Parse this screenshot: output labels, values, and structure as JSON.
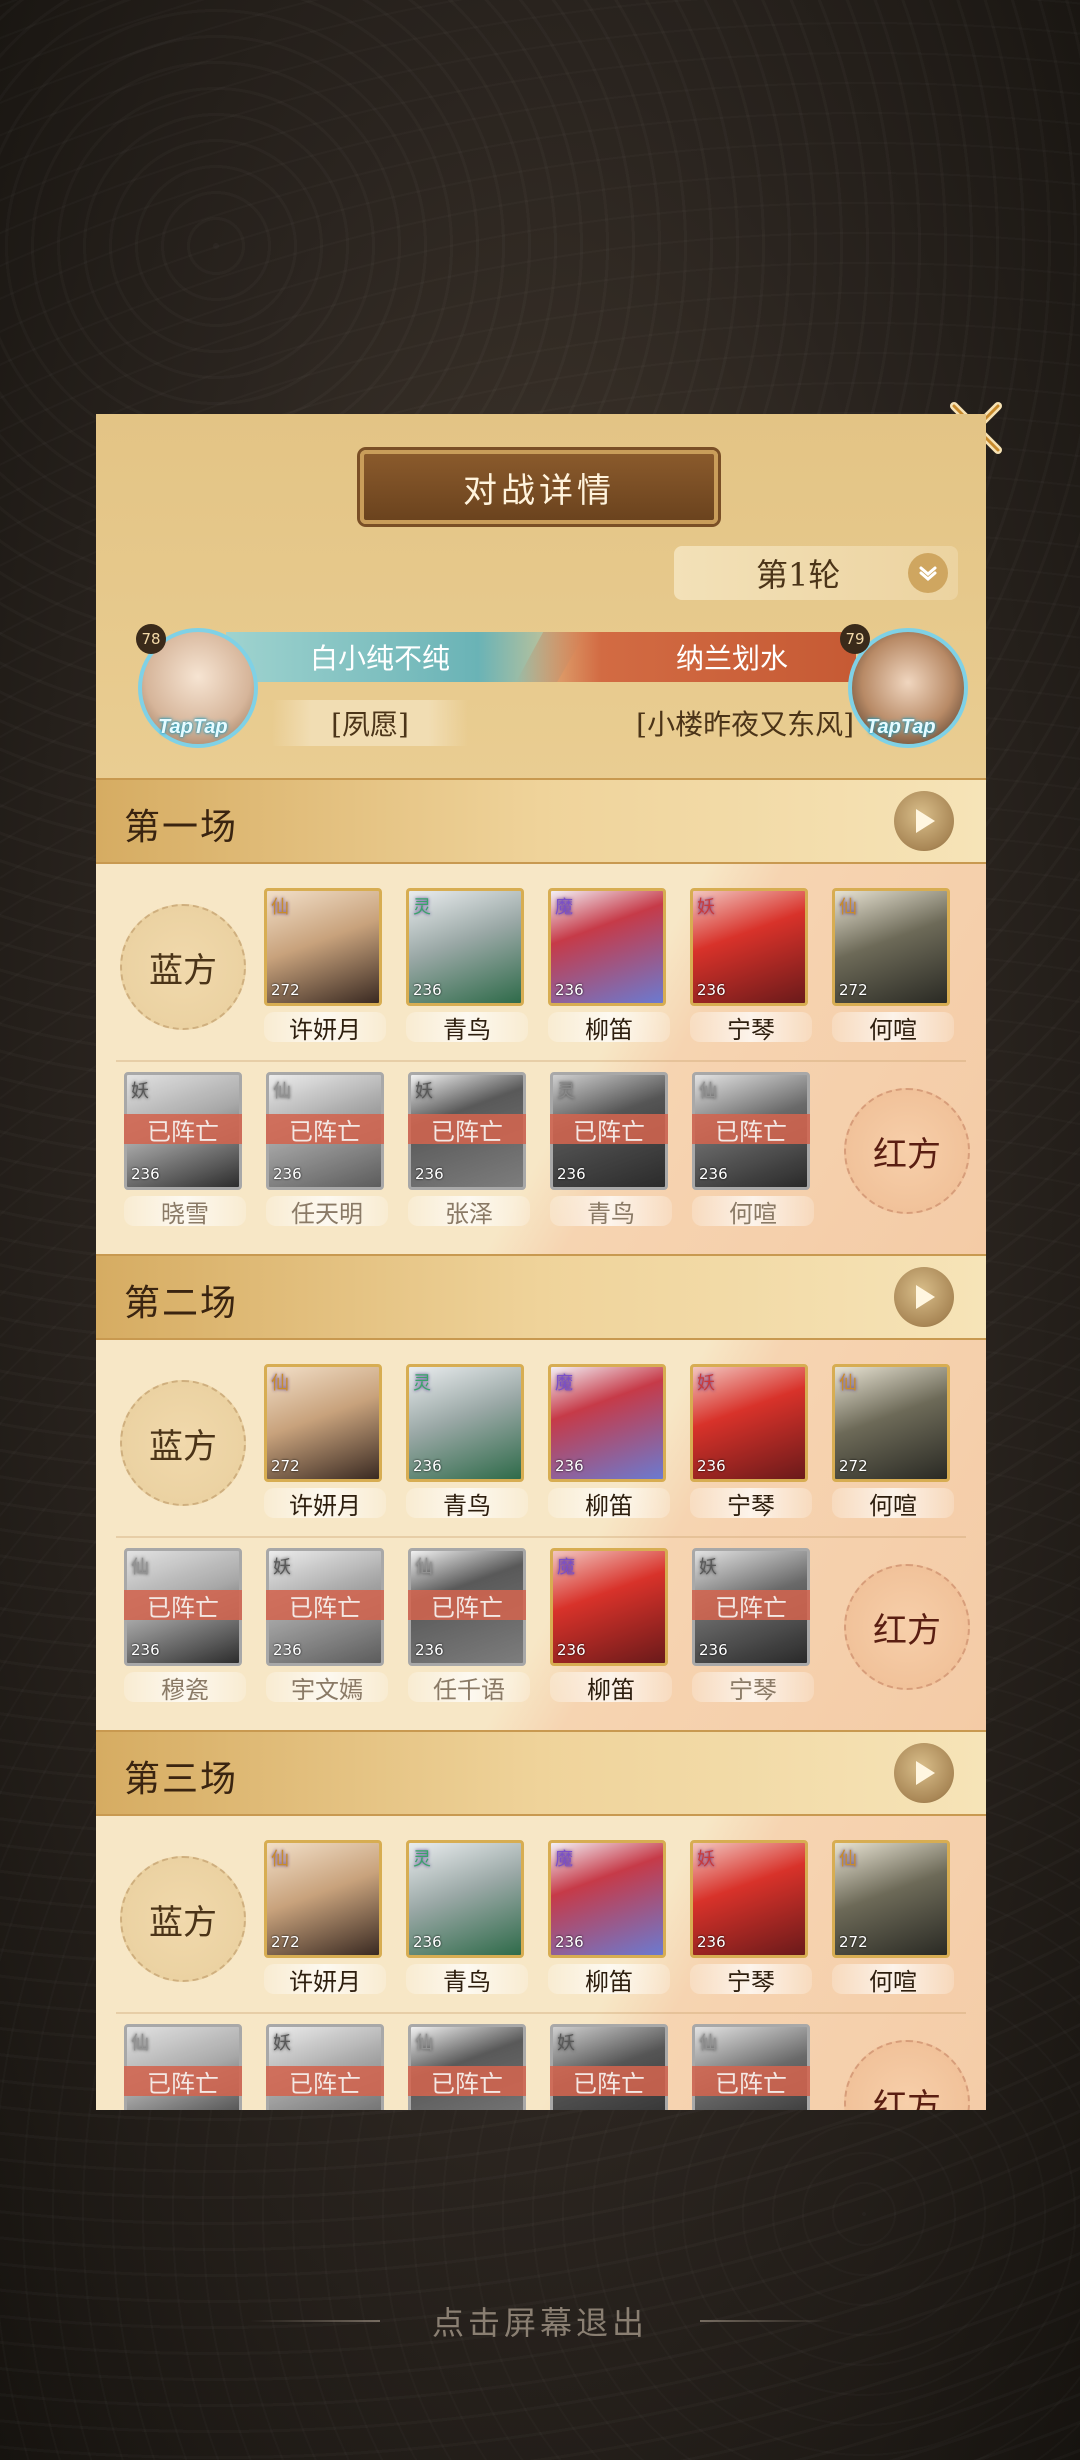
{
  "dialog": {
    "title": "对战详情",
    "round_label": "第1轮",
    "exit_hint": "点击屏幕退出"
  },
  "players": {
    "left": {
      "name": "白小纯不纯",
      "guild": "[夙愿]",
      "level": "78",
      "badge": "TapTap"
    },
    "right": {
      "name": "纳兰划水",
      "guild": "[小楼昨夜又东风]",
      "level": "79",
      "badge": "TapTap"
    }
  },
  "labels": {
    "blue_side": "蓝方",
    "red_side": "红方",
    "defeated": "已阵亡"
  },
  "colors": {
    "panel": "#efd59d",
    "blue_bar": "#6ab3b6",
    "red_bar": "#c65a34",
    "dead_band": "#d2644e",
    "card_border": "#d7ad52"
  },
  "matches": [
    {
      "title": "第一场",
      "blue": [
        {
          "name": "许妍月",
          "tag": "仙",
          "level": "272"
        },
        {
          "name": "青鸟",
          "tag": "灵",
          "level": "236"
        },
        {
          "name": "柳笛",
          "tag": "魔",
          "level": "236"
        },
        {
          "name": "宁琴",
          "tag": "妖",
          "level": "236"
        },
        {
          "name": "何喧",
          "tag": "仙",
          "level": "272"
        }
      ],
      "red": [
        {
          "name": "晓雪",
          "tag": "妖",
          "level": "236",
          "dead": true
        },
        {
          "name": "任天明",
          "tag": "仙",
          "level": "236",
          "dead": true
        },
        {
          "name": "张泽",
          "tag": "妖",
          "level": "236",
          "dead": true
        },
        {
          "name": "青鸟",
          "tag": "灵",
          "level": "236",
          "dead": true
        },
        {
          "name": "何喧",
          "tag": "仙",
          "level": "236",
          "dead": true
        }
      ]
    },
    {
      "title": "第二场",
      "blue": [
        {
          "name": "许妍月",
          "tag": "仙",
          "level": "272"
        },
        {
          "name": "青鸟",
          "tag": "灵",
          "level": "236"
        },
        {
          "name": "柳笛",
          "tag": "魔",
          "level": "236"
        },
        {
          "name": "宁琴",
          "tag": "妖",
          "level": "236"
        },
        {
          "name": "何喧",
          "tag": "仙",
          "level": "272"
        }
      ],
      "red": [
        {
          "name": "穆瓷",
          "tag": "仙",
          "level": "236",
          "dead": true
        },
        {
          "name": "宇文嫣",
          "tag": "妖",
          "level": "236",
          "dead": true
        },
        {
          "name": "任千语",
          "tag": "仙",
          "level": "236",
          "dead": true
        },
        {
          "name": "柳笛",
          "tag": "魔",
          "level": "236",
          "dead": false
        },
        {
          "name": "宁琴",
          "tag": "妖",
          "level": "236",
          "dead": true
        }
      ]
    },
    {
      "title": "第三场",
      "blue": [
        {
          "name": "许妍月",
          "tag": "仙",
          "level": "272"
        },
        {
          "name": "青鸟",
          "tag": "灵",
          "level": "236"
        },
        {
          "name": "柳笛",
          "tag": "魔",
          "level": "236"
        },
        {
          "name": "宁琴",
          "tag": "妖",
          "level": "236"
        },
        {
          "name": "何喧",
          "tag": "仙",
          "level": "272"
        }
      ],
      "red": [
        {
          "name": "",
          "tag": "仙",
          "level": "",
          "dead": true
        },
        {
          "name": "",
          "tag": "妖",
          "level": "",
          "dead": true
        },
        {
          "name": "",
          "tag": "仙",
          "level": "",
          "dead": true
        },
        {
          "name": "",
          "tag": "妖",
          "level": "",
          "dead": true
        },
        {
          "name": "",
          "tag": "仙",
          "level": "",
          "dead": true
        }
      ]
    }
  ]
}
